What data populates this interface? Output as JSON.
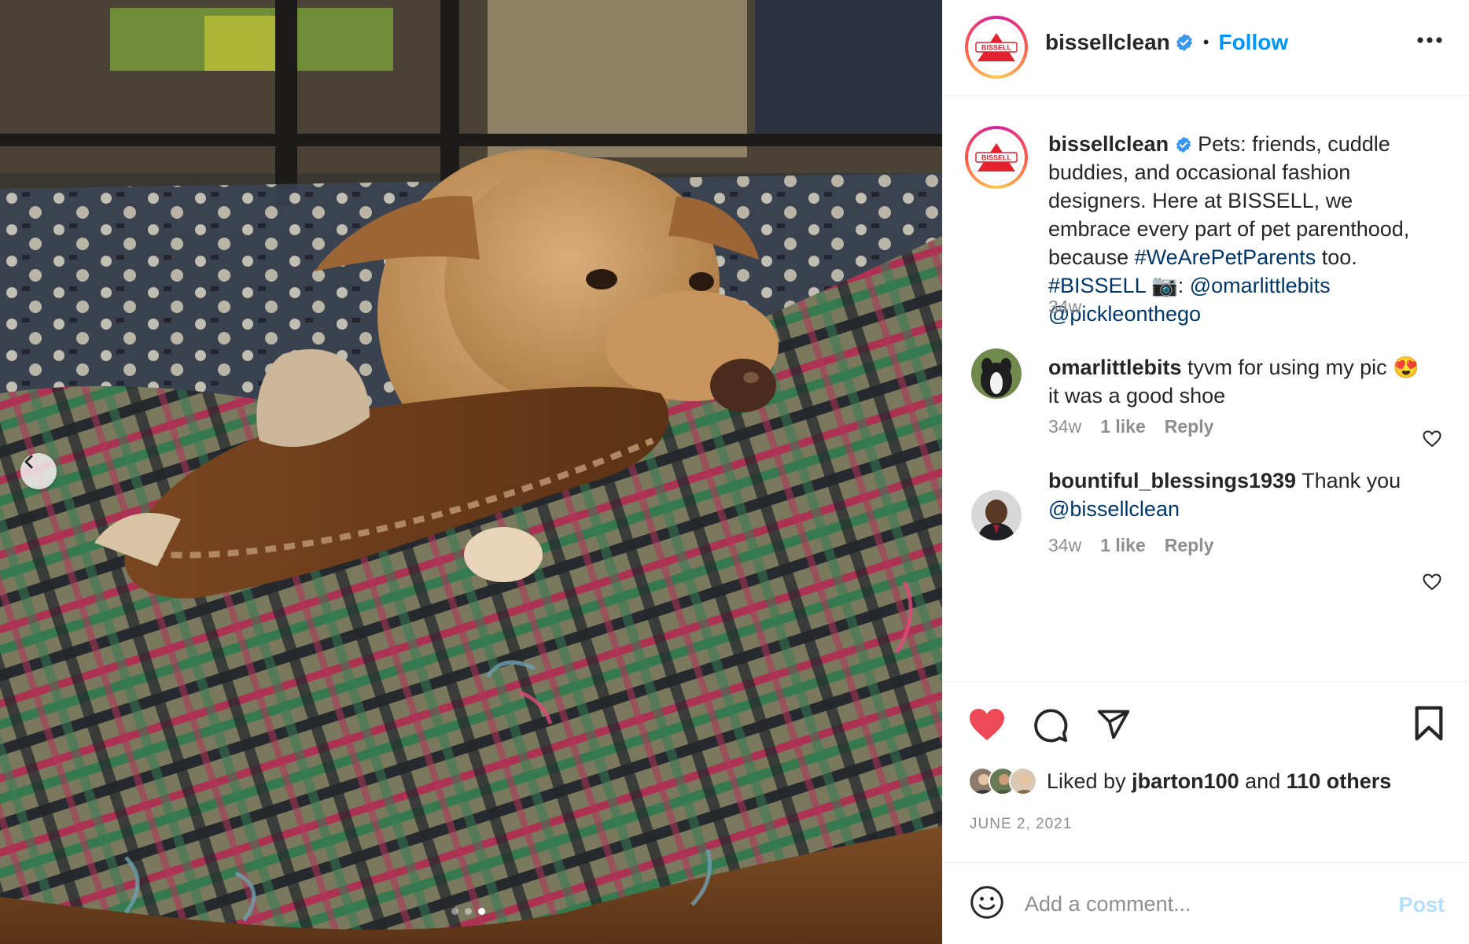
{
  "post": {
    "username": "bissellclean",
    "follow_label": "Follow",
    "separator": "•",
    "logo_text": "BISSELL",
    "brand_color": "#e3212f",
    "link_color": "#00376b",
    "follow_color": "#0095f6"
  },
  "caption": {
    "username": "bissellclean",
    "text_before": "Pets: friends, cuddle buddies, and occasional fashion designers. Here at BISSELL, we embrace every part of pet parenthood, because ",
    "hashtag1": "#WeArePetParents",
    "text_mid": " too. ",
    "hashtag2": "#BISSELL",
    "camera": " 📷: ",
    "mention1": "@omarlittlebits",
    "mention2": "@pickleonthego",
    "age": "34w"
  },
  "comments": [
    {
      "username": "omarlittlebits",
      "text_a": "tyvm for using my pic ",
      "emoji": "😍",
      "text_b": " it was a good shoe",
      "age": "34w",
      "likes": "1 like",
      "reply": "Reply"
    },
    {
      "username": "bountiful_blessings1939",
      "text_a": "Thank you ",
      "mention": "@bissellclean",
      "age": "34w",
      "likes": "1 like",
      "reply": "Reply"
    }
  ],
  "actions": {
    "liked_by_prefix": "Liked by",
    "liked_by_user": "jbarton100",
    "and": "and",
    "others": "110 others",
    "date": "JUNE 2, 2021",
    "heart_color": "#ed4956"
  },
  "comment_box": {
    "placeholder": "Add a comment...",
    "post_label": "Post"
  },
  "carousel": {
    "total": 3,
    "current": 3
  },
  "icons": [
    "verified-badge-icon",
    "more-options-icon",
    "heart-icon",
    "comment-icon",
    "share-icon",
    "bookmark-icon",
    "emoji-icon",
    "chevron-left-icon"
  ]
}
